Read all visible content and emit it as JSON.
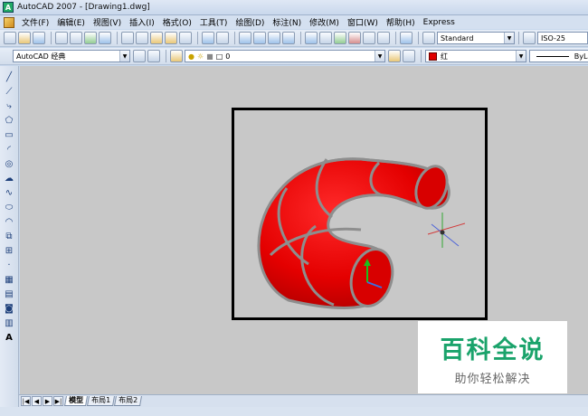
{
  "window": {
    "title": "AutoCAD 2007 - [Drawing1.dwg]"
  },
  "menu": [
    "文件(F)",
    "编辑(E)",
    "视图(V)",
    "插入(I)",
    "格式(O)",
    "工具(T)",
    "绘图(D)",
    "标注(N)",
    "修改(M)",
    "窗口(W)",
    "帮助(H)",
    "Express"
  ],
  "toolbar": {
    "text_style": "Standard",
    "dim_style": "ISO-25"
  },
  "toolbar2": {
    "workspace": "AutoCAD 经典",
    "layer": "0",
    "color": "红",
    "linetype": "ByLaye",
    "color_hex": "#e00000"
  },
  "tabs": {
    "model": "模型",
    "layout1": "布局1",
    "layout2": "布局2"
  },
  "watermark": {
    "main": "百科全说",
    "sub": "助你轻松解决"
  },
  "colors": {
    "torus": "#e00000",
    "wire": "#8e8e8e",
    "canvas": "#c8c8c8"
  }
}
